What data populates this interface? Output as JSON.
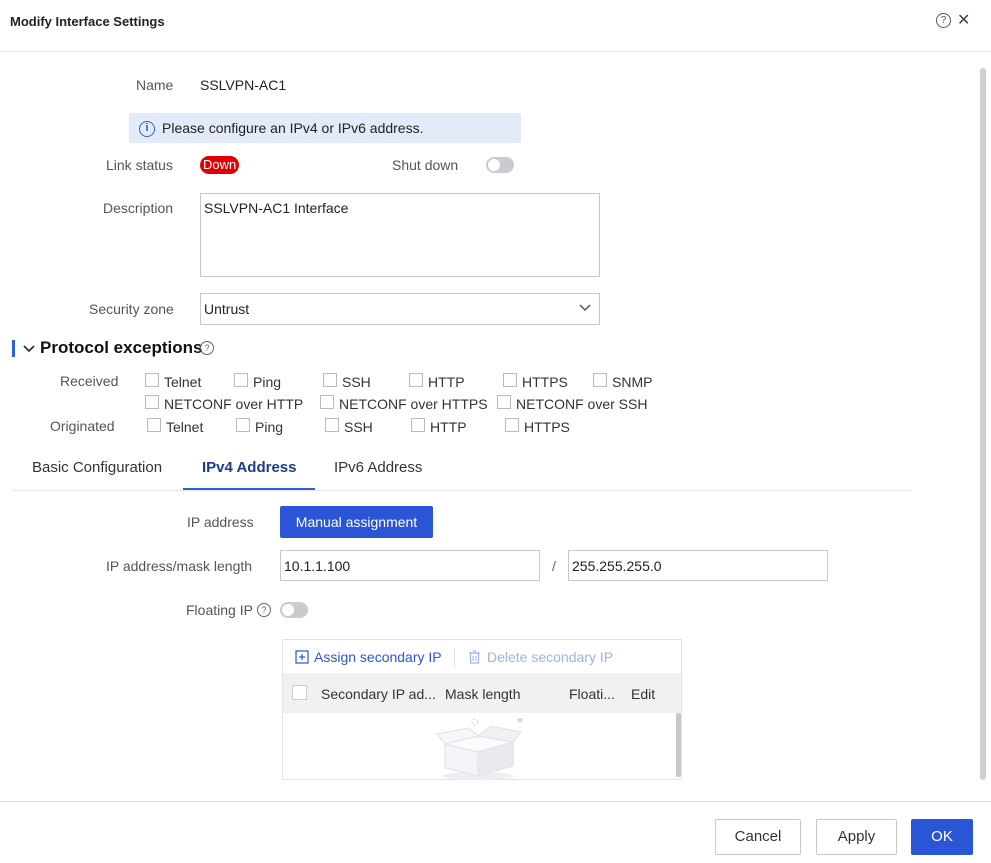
{
  "dialog": {
    "title": "Modify Interface Settings"
  },
  "form": {
    "name_label": "Name",
    "name_value": "SSLVPN-AC1",
    "info_message": "Please configure an IPv4 or IPv6 address.",
    "link_status_label": "Link status",
    "link_status_value": "Down",
    "shutdown_label": "Shut down",
    "description_label": "Description",
    "description_value": "SSLVPN-AC1 Interface",
    "security_zone_label": "Security zone",
    "security_zone_value": "Untrust"
  },
  "protocol_exceptions": {
    "title": "Protocol exceptions",
    "received_label": "Received",
    "originated_label": "Originated",
    "received_row1": [
      "Telnet",
      "Ping",
      "SSH",
      "HTTP",
      "HTTPS",
      "SNMP"
    ],
    "received_row2": [
      "NETCONF over HTTP",
      "NETCONF over HTTPS",
      "NETCONF over SSH"
    ],
    "originated": [
      "Telnet",
      "Ping",
      "SSH",
      "HTTP",
      "HTTPS"
    ]
  },
  "tabs": [
    {
      "label": "Basic Configuration"
    },
    {
      "label": "IPv4 Address"
    },
    {
      "label": "IPv6 Address"
    }
  ],
  "ipv4": {
    "ip_address_label": "IP address",
    "manual_assignment": "Manual assignment",
    "ip_mask_label": "IP address/mask length",
    "ip_value": "10.1.1.100",
    "separator": "/",
    "mask_value": "255.255.255.0",
    "floating_ip_label": "Floating IP"
  },
  "secondary": {
    "assign_label": "Assign secondary IP",
    "delete_label": "Delete secondary IP",
    "columns": [
      "Secondary IP ad...",
      "Mask length",
      "Floati...",
      "Edit"
    ]
  },
  "footer": {
    "cancel": "Cancel",
    "apply": "Apply",
    "ok": "OK"
  },
  "colors": {
    "primary": "#2a55d6",
    "status_down": "#e30000",
    "info_bg": "#e3ebf8"
  }
}
